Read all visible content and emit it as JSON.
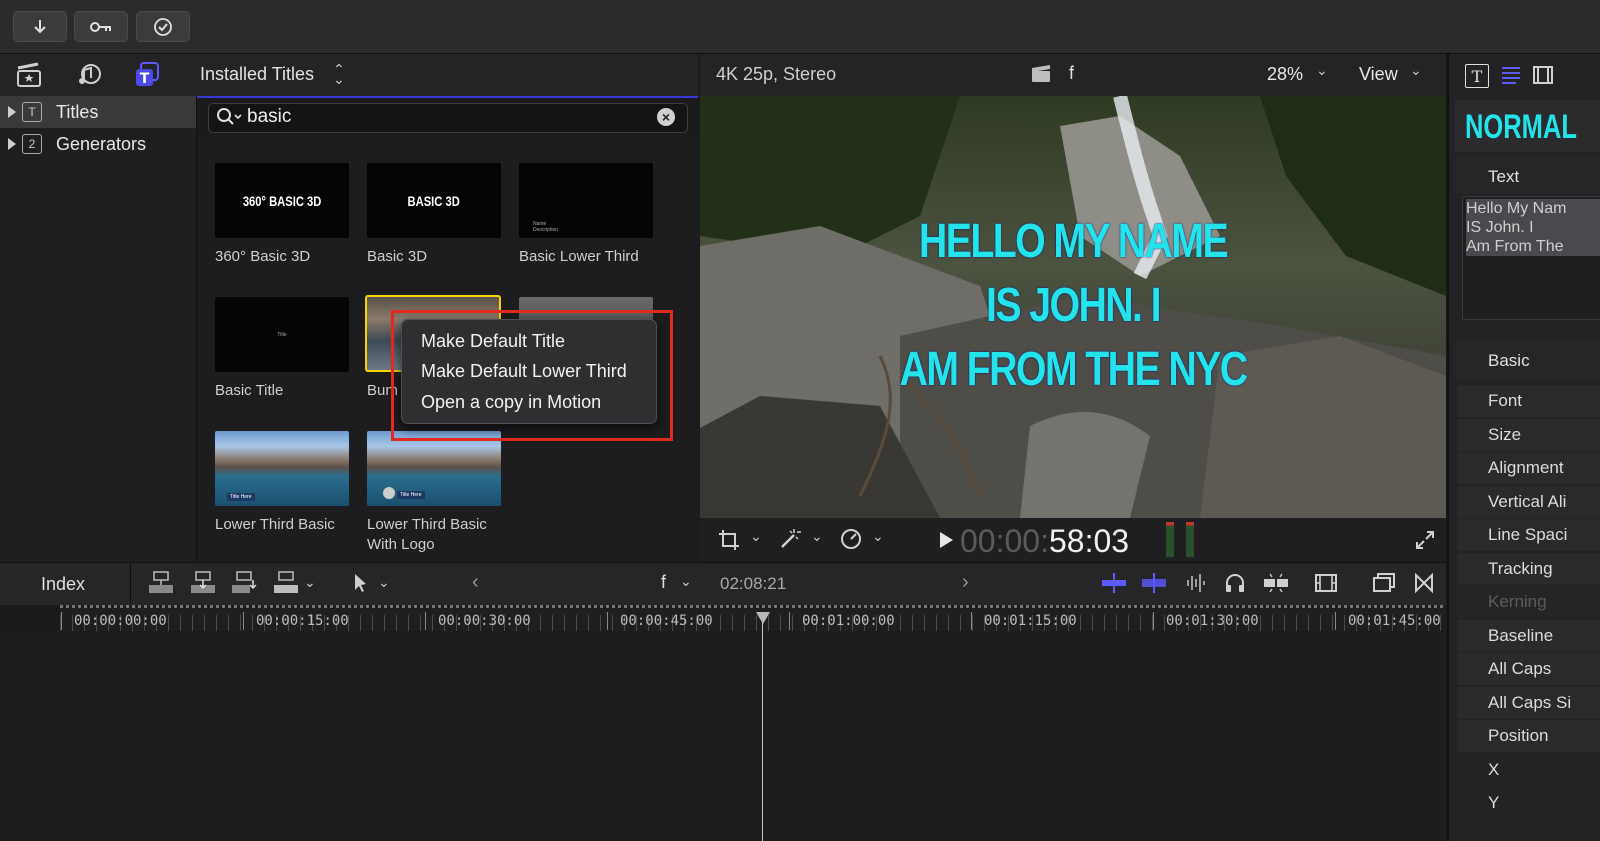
{
  "toolbar": {
    "import_icon": "arrow-down-icon",
    "keyword_icon": "key-icon",
    "check_icon": "checkmark-circle-icon"
  },
  "browser": {
    "title": "Installed Titles",
    "sidebar": [
      {
        "label": "Titles",
        "badge": "T",
        "selected": true
      },
      {
        "label": "Generators",
        "badge": "2",
        "selected": false
      }
    ],
    "search": {
      "value": "basic"
    },
    "thumbnails": [
      {
        "label": "360° Basic 3D",
        "thumb_text": "360° BASIC 3D"
      },
      {
        "label": "Basic 3D",
        "thumb_text": "BASIC 3D"
      },
      {
        "label": "Basic Lower Third",
        "thumb_text": "Name\nDescription"
      },
      {
        "label": "Basic Title",
        "thumb_text": "Title"
      },
      {
        "label": "Bum",
        "thumb_text": ""
      },
      {
        "label": "",
        "thumb_text": ""
      },
      {
        "label": "Lower Third Basic",
        "thumb_text": "Title Here"
      },
      {
        "label": "Lower Third Basic With Logo",
        "label_line1": "Lower Third Basic",
        "label_line2": "With Logo",
        "thumb_text": "Title Here"
      }
    ],
    "context_menu": [
      "Make Default Title",
      "Make Default Lower Third",
      "Open a copy in Motion"
    ]
  },
  "viewer": {
    "format": "4K 25p, Stereo",
    "clip_label": "f",
    "zoom": "28%",
    "view_label": "View",
    "overlay_lines": [
      "HELLO MY NAME",
      "IS JOHN. I",
      "AM FROM THE NYC"
    ],
    "timecode_dim": "00:00:",
    "timecode": "58:03"
  },
  "inspector": {
    "title_preview": "NORMAL",
    "text_section": "Text",
    "text_lines": [
      "Hello My Nam",
      "IS John. I",
      "Am From The"
    ],
    "basic_section": "Basic",
    "rows": [
      "Font",
      "Size",
      "Alignment",
      "Vertical Ali",
      "Line Spaci",
      "Tracking",
      "Kerning",
      "Baseline",
      "All Caps",
      "All Caps Si",
      "Position",
      "X",
      "Y"
    ]
  },
  "timeline": {
    "index_label": "Index",
    "clip_label": "f",
    "duration": "02:08:21",
    "ruler": [
      "00:00:00:00",
      "00:00:15:00",
      "00:00:30:00",
      "00:00:45:00",
      "00:01:00:00",
      "00:01:15:00",
      "00:01:30:00",
      "00:01:45:00"
    ]
  },
  "colors": {
    "accent": "#3a3ad8",
    "selection_yellow": "#f5d400",
    "highlight_red": "#e02a1e",
    "overlay_cyan": "#22e4ea"
  }
}
